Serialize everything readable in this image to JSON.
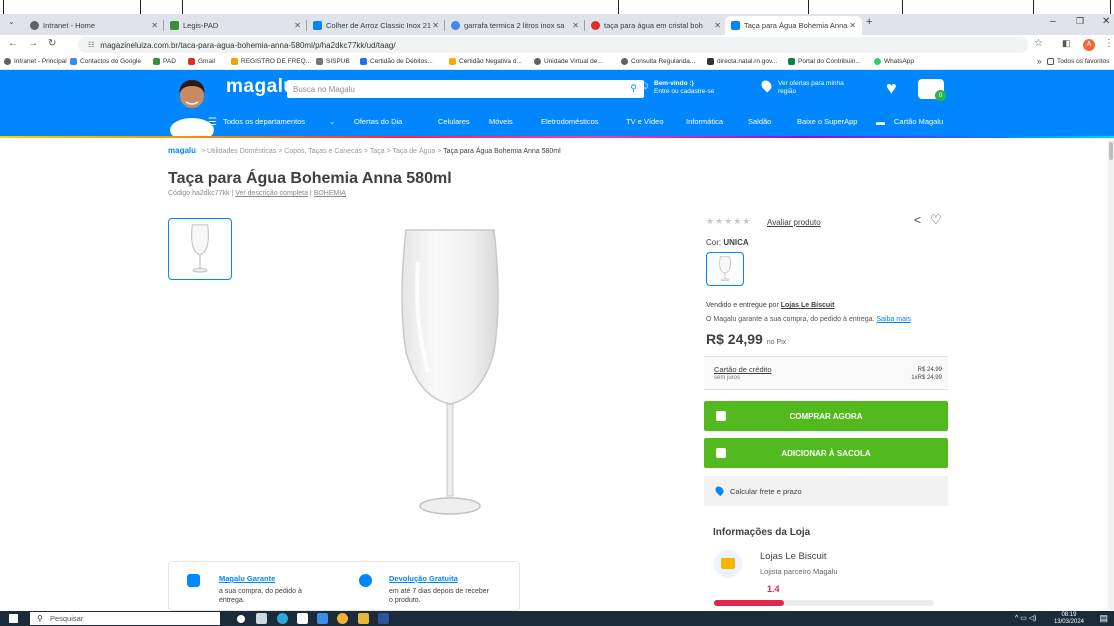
{
  "tabs": [
    {
      "label": "Intranet - Home",
      "color": "#5f6368"
    },
    {
      "label": "Legis-PAD",
      "color": "#3b8d3b"
    },
    {
      "label": "Colher de Arroz Classic Inox 21",
      "color": "#0086ff"
    },
    {
      "label": "garrafa termica 2 litros inox sa",
      "color": "#4285f4"
    },
    {
      "label": "taça para água em cristal boh",
      "color": "#d93025"
    },
    {
      "label": "Taça para Água Bohemia Anna",
      "color": "#0086ff"
    }
  ],
  "address": {
    "url": "magazineluiza.com.br/taca-para-agua-bohemia-anna-580ml/p/ha2dkc77kk/ud/taag/"
  },
  "bookmarks": [
    {
      "label": "Intranet - Principal",
      "color": "#5f6368"
    },
    {
      "label": "Contactos do Google",
      "color": "#4285f4"
    },
    {
      "label": "PAD",
      "color": "#3b8d3b"
    },
    {
      "label": "Gmail",
      "color": "#d93025"
    },
    {
      "label": "REGISTRO DE FREQ...",
      "color": "#f4a400"
    },
    {
      "label": "SISPUB",
      "color": "#777777"
    },
    {
      "label": "Certidão de Débitos...",
      "color": "#1a73e8"
    },
    {
      "label": "Certidão Negativa d...",
      "color": "#f9ab00"
    },
    {
      "label": "Unidade Virtual de...",
      "color": "#5f6368"
    },
    {
      "label": "Consulta Regularida...",
      "color": "#5f6368"
    },
    {
      "label": "directa.natal.rn.gov...",
      "color": "#333333"
    },
    {
      "label": "Portal do Contribuin...",
      "color": "#0b8043"
    },
    {
      "label": "WhatsApp",
      "color": "#25d366"
    }
  ],
  "bookmarks_all": "Todos os favoritos",
  "header": {
    "logo": "magalu",
    "search_placeholder": "Busca no Magalu",
    "welcome": "Bem-vindo :)",
    "signin": "Entre ou cadastre-se",
    "offers": "Ver ofertas para minha",
    "region": "região",
    "cart_count": "0"
  },
  "menu": {
    "departments": "Todos os departamentos",
    "items": [
      "Ofertas do Dia",
      "Celulares",
      "Móveis",
      "Eletrodomésticos",
      "TV e Vídeo",
      "Informática",
      "Saldão",
      "Baixe o SuperApp",
      "Cartão Magalu"
    ]
  },
  "breadcrumb": {
    "brand": "magalu",
    "items": [
      "Utilidades Domésticas",
      "Copos, Taças e Canecas",
      "Taça",
      "Taça de Água"
    ],
    "current": "Taça para Água Bohemia Anna 580ml"
  },
  "product": {
    "title": "Taça para Água Bohemia Anna 580ml",
    "code_prefix": "Código ha2dkc77kk |",
    "description_link": "Ver descrição completa",
    "brand_link": "BOHEMIA",
    "rate_label": "Avaliar produto",
    "color_label": "Cor:",
    "color_value": "UNICA",
    "sold_by": "Vendido e entregue por",
    "seller": "Lojas Le Biscuit",
    "guarantee_text": "O Magalu garante a sua compra, do pedido à entrega.",
    "guarantee_link": "Saiba mais",
    "price": "R$ 24,99",
    "price_suffix": "no Pix",
    "credit_label": "Cartão de crédito",
    "credit_sub": "sem juros",
    "credit_price": "R$ 24,99",
    "credit_installment": "1xR$ 24,99",
    "buy_now": "COMPRAR AGORA",
    "add_bag": "ADICIONAR À SACOLA",
    "shipping": "Calcular frete e prazo"
  },
  "store": {
    "title": "Informações da Loja",
    "name": "Lojas Le Biscuit",
    "sub": "Lojista parceiro Magalu",
    "score": "1.4"
  },
  "guarantees": [
    {
      "title": "Magalu Garante",
      "line1": "a sua compra, do pedido à",
      "line2": "entrega."
    },
    {
      "title": "Devolução Gratuita",
      "line1": "em até 7 dias depois de receber",
      "line2": "o produto."
    }
  ],
  "taskbar": {
    "search": "Pesquisar",
    "time": "08:19",
    "date": "13/03/2024"
  },
  "colors": {
    "brand": "#0086ff",
    "buy": "#52b91f",
    "score": "#e0264b"
  }
}
